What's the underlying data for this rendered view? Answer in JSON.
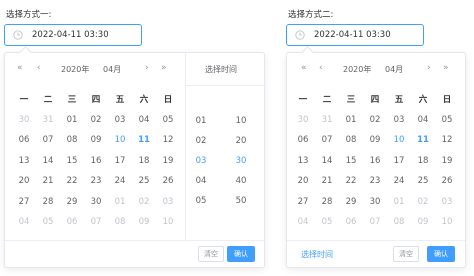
{
  "picker1": {
    "label": "选择方式一:",
    "value": "2022-04-11 03:30",
    "header": {
      "prev_year": "«",
      "prev_month": "‹",
      "year": "2020年",
      "month": "04月",
      "next_month": "›",
      "next_year": "»",
      "time_title": "选择时间"
    },
    "weekdays": [
      "一",
      "二",
      "三",
      "四",
      "五",
      "六",
      "日"
    ],
    "days": [
      [
        "30",
        "31",
        "01",
        "02",
        "03",
        "04",
        "05"
      ],
      [
        "06",
        "07",
        "08",
        "09",
        "10",
        "11",
        "12"
      ],
      [
        "13",
        "14",
        "15",
        "16",
        "17",
        "18",
        "19"
      ],
      [
        "20",
        "21",
        "22",
        "23",
        "24",
        "25",
        "26"
      ],
      [
        "27",
        "28",
        "29",
        "30",
        "01",
        "02",
        "03"
      ],
      [
        "04",
        "05",
        "06",
        "07",
        "08",
        "09",
        "10"
      ]
    ],
    "hours": [
      "01",
      "02",
      "03",
      "04",
      "05"
    ],
    "minutes": [
      "10",
      "20",
      "30",
      "40",
      "50"
    ],
    "clear": "清空",
    "confirm": "确认"
  },
  "picker2": {
    "label": "选择方式二:",
    "value": "2022-04-11 03:30",
    "header": {
      "prev_year": "«",
      "prev_month": "‹",
      "year": "2020年",
      "month": "04月",
      "next_month": "›",
      "next_year": "»"
    },
    "weekdays": [
      "一",
      "二",
      "三",
      "四",
      "五",
      "六",
      "日"
    ],
    "days": [
      [
        "30",
        "31",
        "01",
        "02",
        "03",
        "04",
        "05"
      ],
      [
        "06",
        "07",
        "08",
        "09",
        "10",
        "11",
        "12"
      ],
      [
        "13",
        "14",
        "15",
        "16",
        "17",
        "18",
        "19"
      ],
      [
        "20",
        "21",
        "22",
        "23",
        "24",
        "25",
        "26"
      ],
      [
        "27",
        "28",
        "29",
        "30",
        "01",
        "02",
        "03"
      ],
      [
        "04",
        "05",
        "06",
        "07",
        "08",
        "09",
        "10"
      ]
    ],
    "select_time": "选择时间",
    "clear": "清空",
    "confirm": "确认"
  },
  "colors": {
    "accent": "#409eff",
    "muted": "#c0c4cc",
    "text": "#606266"
  }
}
